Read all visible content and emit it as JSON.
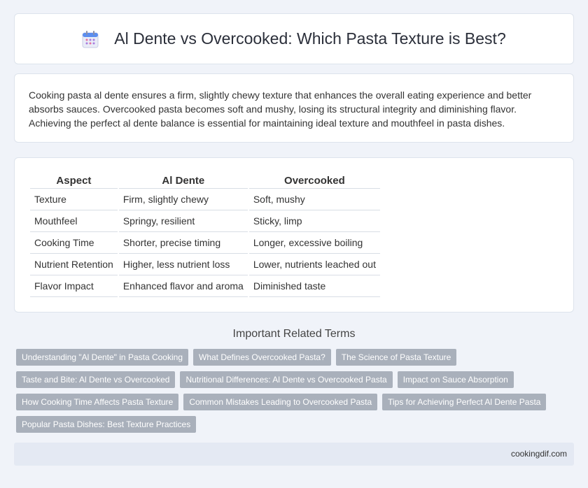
{
  "header": {
    "title": "Al Dente vs Overcooked: Which Pasta Texture is Best?",
    "icon": "calendar-icon"
  },
  "intro": {
    "text": "Cooking pasta al dente ensures a firm, slightly chewy texture that enhances the overall eating experience and better absorbs sauces. Overcooked pasta becomes soft and mushy, losing its structural integrity and diminishing flavor. Achieving the perfect al dente balance is essential for maintaining ideal texture and mouthfeel in pasta dishes."
  },
  "table": {
    "headers": [
      "Aspect",
      "Al Dente",
      "Overcooked"
    ],
    "rows": [
      [
        "Texture",
        "Firm, slightly chewy",
        "Soft, mushy"
      ],
      [
        "Mouthfeel",
        "Springy, resilient",
        "Sticky, limp"
      ],
      [
        "Cooking Time",
        "Shorter, precise timing",
        "Longer, excessive boiling"
      ],
      [
        "Nutrient Retention",
        "Higher, less nutrient loss",
        "Lower, nutrients leached out"
      ],
      [
        "Flavor Impact",
        "Enhanced flavor and aroma",
        "Diminished taste"
      ]
    ]
  },
  "related": {
    "title": "Important Related Terms",
    "tags": [
      "Understanding \"Al Dente\" in Pasta Cooking",
      "What Defines Overcooked Pasta?",
      "The Science of Pasta Texture",
      "Taste and Bite: Al Dente vs Overcooked",
      "Nutritional Differences: Al Dente vs Overcooked Pasta",
      "Impact on Sauce Absorption",
      "How Cooking Time Affects Pasta Texture",
      "Common Mistakes Leading to Overcooked Pasta",
      "Tips for Achieving Perfect Al Dente Pasta",
      "Popular Pasta Dishes: Best Texture Practices"
    ]
  },
  "footer": {
    "site": "cookingdif.com"
  }
}
